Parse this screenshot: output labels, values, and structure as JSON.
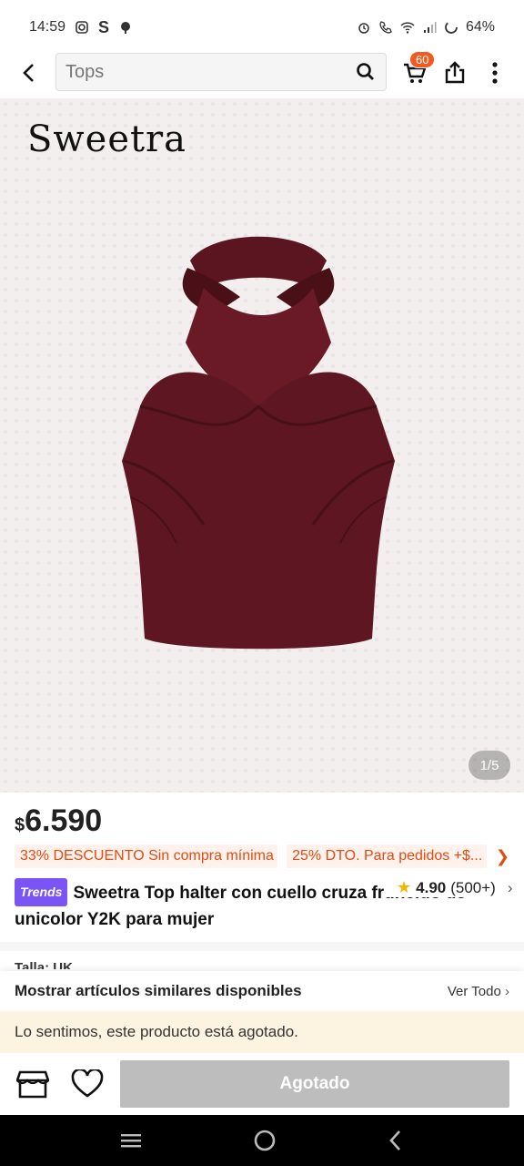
{
  "status_bar": {
    "time": "14:59",
    "battery": "64%",
    "left_icons": [
      "instagram-icon",
      "s-app-icon",
      "cloud-icon"
    ],
    "right_icons": [
      "alarm-icon",
      "wifi-calling-icon",
      "wifi-icon",
      "signal-icon",
      "battery-icon"
    ]
  },
  "header": {
    "search_placeholder": "Tops",
    "cart_count": "60",
    "icons": [
      "back-arrow-icon",
      "search-icon",
      "cart-icon",
      "share-icon",
      "more-vertical-icon"
    ]
  },
  "gallery": {
    "brand_logo": "Sweetra",
    "counter": "1/5"
  },
  "product": {
    "currency": "$",
    "price": "6.590",
    "promos": [
      "33% DESCUENTO Sin compra mínima",
      "25% DTO. Para pedidos +$..."
    ],
    "badge": "Trends",
    "title": "Sweetra Top halter con cuello cruza fruncido de unicolor Y2K para mujer",
    "rating": "4.90",
    "rating_count": "(500+)"
  },
  "partial_row_text": "Talla: UK",
  "similar": {
    "title": "Mostrar artículos similares disponibles",
    "see_all": "Ver Todo"
  },
  "out_of_stock_message": "Lo sentimos, este producto está agotado.",
  "actions": {
    "sold_out_label": "Agotado"
  },
  "colors": {
    "accent_orange": "#e24b14",
    "badge_orange": "#f35a21",
    "trends_purple": "#7b54f5",
    "product_maroon": "#5a1520",
    "star_yellow": "#f5b400",
    "disabled_gray": "#bdbdbd"
  }
}
